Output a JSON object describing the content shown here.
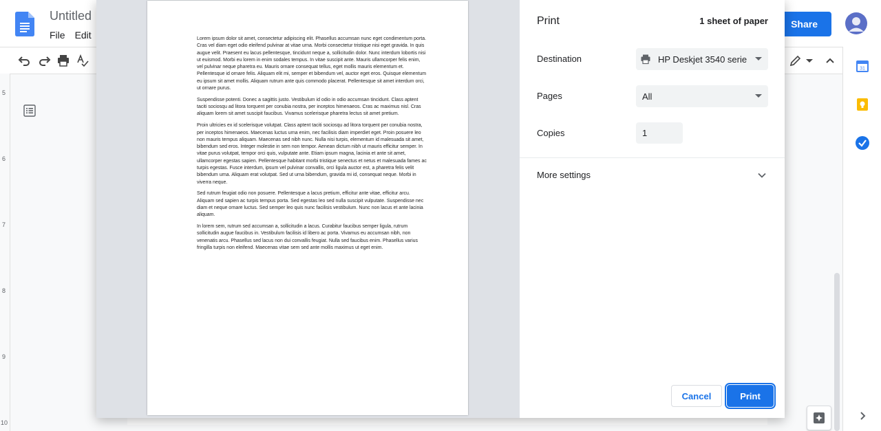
{
  "docs": {
    "title": "Untitled",
    "menu": [
      "File",
      "Edit"
    ],
    "share_label": "Share",
    "ruler_numbers": [
      "5",
      "6",
      "7",
      "8",
      "9",
      "10"
    ]
  },
  "print_dialog": {
    "title": "Print",
    "sheets": "1 sheet of paper",
    "destination_label": "Destination",
    "destination_value": "HP Deskjet 3540 serie",
    "pages_label": "Pages",
    "pages_value": "All",
    "copies_label": "Copies",
    "copies_value": "1",
    "more_settings_label": "More settings",
    "cancel_label": "Cancel",
    "print_label": "Print"
  },
  "preview": {
    "paragraphs": [
      "Lorem ipsum dolor sit amet, consectetur adipiscing elit. Phasellus accumsan nunc eget condimentum porta. Cras vel diam eget odio eleifend pulvinar at vitae urna. Morbi consectetur tristique nisi eget gravida. In quis augue velit. Praesent eu lacus pellentesque, tincidunt neque a, sollicitudin dolor. Nunc interdum lobortis nisi ut euismod. Morbi eu lorem in enim sodales tempus. In vitae suscipit ante. Mauris ullamcorper felis enim, vel pulvinar neque pharetra eu. Mauris ornare consequat tellus, eget mollis mauris elementum et. Pellentesque id ornare felis. Aliquam elit mi, semper et bibendum vel, auctor eget eros. Quisque elementum eu ipsum sit amet mollis. Aliquam rutrum ante quis commodo placerat. Pellentesque sit amet interdum orci, ut ornare purus.",
      "Suspendisse potenti. Donec a sagittis justo. Vestibulum id odio in odio accumsan tincidunt. Class aptent taciti sociosqu ad litora torquent per conubia nostra, per inceptos himenaeos. Cras ac maximus nisl. Cras aliquam lorem sit amet suscipit faucibus. Vivamus scelerisque pharetra lectus sit amet pretium.",
      "Proin ultricies ex id scelerisque volutpat. Class aptent taciti sociosqu ad litora torquent per conubia nostra, per inceptos himenaeos. Maecenas luctus urna enim, nec facilisis diam imperdiet eget. Proin posuere leo non mauris tempus aliquam. Maecenas sed nibh nunc. Nulla nisi turpis, elementum id malesuada sit amet, bibendum sed eros. Integer molestie in sem non tempor. Aenean dictum nibh ut mauris efficitur semper. In vitae purus volutpat, tempor orci quis, vulputate ante. Etiam ipsum magna, lacinia et ante sit amet, ullamcorper egestas sapien. Pellentesque habitant morbi tristique senectus et netus et malesuada fames ac turpis egestas. Fusce interdum, ipsum vel pulvinar convallis, orci ligula auctor est, a pharetra felis velit bibendum urna. Aliquam erat volutpat. Sed ut urna bibendum, gravida mi id, consequat neque. Morbi in viverra neque.",
      "Sed rutrum feugiat odio non posuere. Pellentesque a lacus pretium, efficitur ante vitae, efficitur arcu. Aliquam sed sapien ac turpis tempus porta. Sed egestas leo sed nulla suscipit vulputate. Suspendisse nec diam et neque ornare luctus. Sed semper leo quis nunc facilisis vestibulum. Nunc non lacus et ante lacinia aliquam.",
      "In lorem sem, rutrum sed accumsan a, sollicitudin a lacus. Curabitur faucibus semper ligula, rutrum sollicitudin augue faucibus in. Vestibulum facilisis id libero ac porta. Vivamus eu accumsan nibh, non venenatis arcu. Phasellus sed lacus non dui convallis feugiat. Nulla sed faucibus enim. Phasellus varius fringilla turpis non eleifend. Maecenas vitae sem sed ante mollis maximus ut eget enim."
    ]
  },
  "icons": {
    "docs_logo": "docs-logo-icon",
    "undo": "undo-icon",
    "redo": "redo-icon",
    "print": "print-icon",
    "spellcheck": "spellcheck-icon",
    "edit_mode": "pencil-icon",
    "collapse": "chevron-up-icon",
    "outline": "outline-icon",
    "calendar": "calendar-icon",
    "keep": "keep-icon",
    "tasks": "tasks-icon",
    "explore": "explore-icon",
    "side_expand": "chevron-right-icon",
    "printer": "printer-icon",
    "more_chevron": "chevron-down-icon"
  },
  "colors": {
    "accent": "#1a73e8",
    "avatar": "#5b6fc7"
  }
}
